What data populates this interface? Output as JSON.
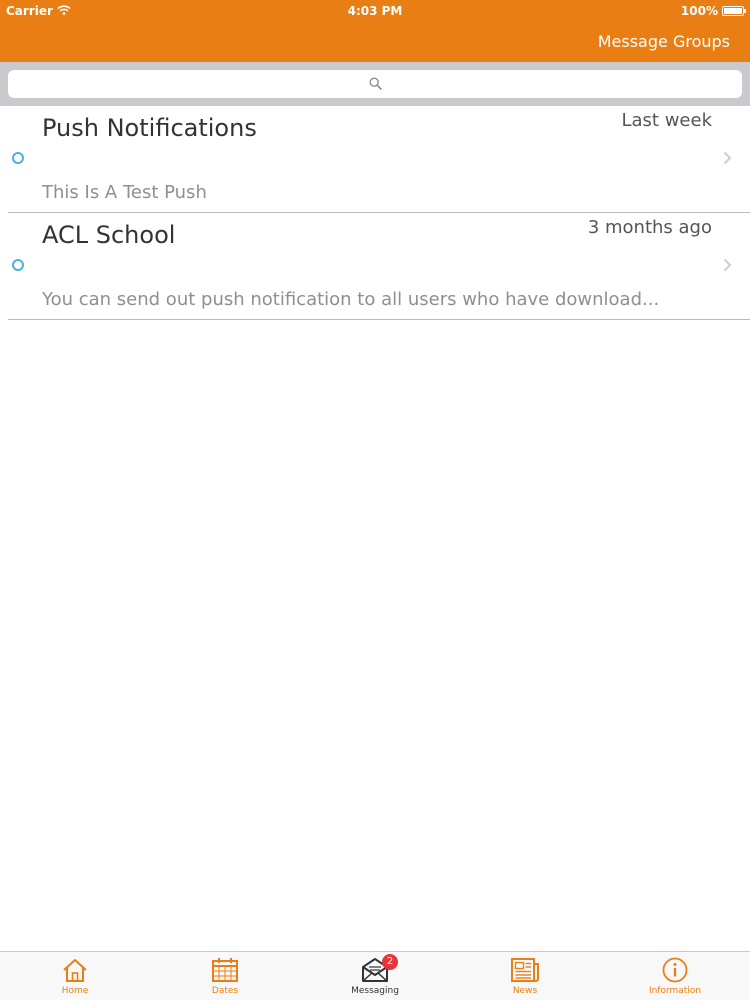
{
  "status_bar": {
    "carrier": "Carrier",
    "time": "4:03 PM",
    "battery": "100%"
  },
  "nav": {
    "title": "Message Groups"
  },
  "search": {
    "placeholder": ""
  },
  "messages": [
    {
      "title": "Push Notifications",
      "time": "Last week",
      "subtitle": "This Is A Test Push"
    },
    {
      "title": "ACL School",
      "time": "3 months ago",
      "subtitle": "You can send out push notification to all users who have download..."
    }
  ],
  "tabs": [
    {
      "label": "Home",
      "icon": "home-icon"
    },
    {
      "label": "Dates",
      "icon": "calendar-icon"
    },
    {
      "label": "Messaging",
      "icon": "envelope-icon",
      "badge": "2"
    },
    {
      "label": "News",
      "icon": "newspaper-icon"
    },
    {
      "label": "Information",
      "icon": "info-icon"
    }
  ],
  "colors": {
    "accent": "#e97f14",
    "badge": "#e9353a",
    "unread_dot": "#4ab0e0"
  }
}
